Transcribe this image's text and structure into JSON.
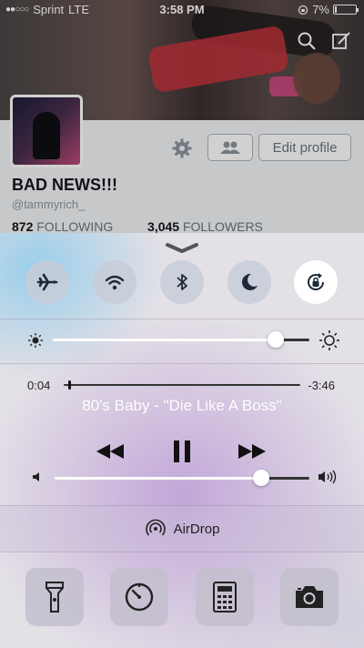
{
  "status_bar": {
    "carrier": "Sprint",
    "network": "LTE",
    "time": "3:58 PM",
    "battery_percent_text": "7%",
    "battery_level": 0.07
  },
  "profile": {
    "name": "BAD NEWS!!!",
    "handle": "@tammyrich_",
    "following_count": "872",
    "following_label": "FOLLOWING",
    "followers_count": "3,045",
    "followers_label": "FOLLOWERS",
    "edit_profile_label": "Edit profile"
  },
  "control_center": {
    "toggles": [
      {
        "name": "airplane-mode",
        "icon": "airplane-icon",
        "on": false
      },
      {
        "name": "wifi",
        "icon": "wifi-icon",
        "on": false
      },
      {
        "name": "bluetooth",
        "icon": "bluetooth-icon",
        "on": false
      },
      {
        "name": "do-not-disturb",
        "icon": "moon-icon",
        "on": false
      },
      {
        "name": "rotation-lock",
        "icon": "rotation-lock-icon",
        "on": true
      }
    ],
    "brightness_level": 0.87,
    "music": {
      "elapsed": "0:04",
      "remaining": "-3:46",
      "progress": 0.018,
      "title": "80's Baby - \"Die Like A Boss\"",
      "volume_level": 0.81
    },
    "airdrop_label": "AirDrop",
    "tools": [
      {
        "name": "flashlight",
        "icon": "flashlight-icon"
      },
      {
        "name": "timer",
        "icon": "timer-icon"
      },
      {
        "name": "calculator",
        "icon": "calculator-icon"
      },
      {
        "name": "camera",
        "icon": "camera-icon"
      }
    ]
  }
}
